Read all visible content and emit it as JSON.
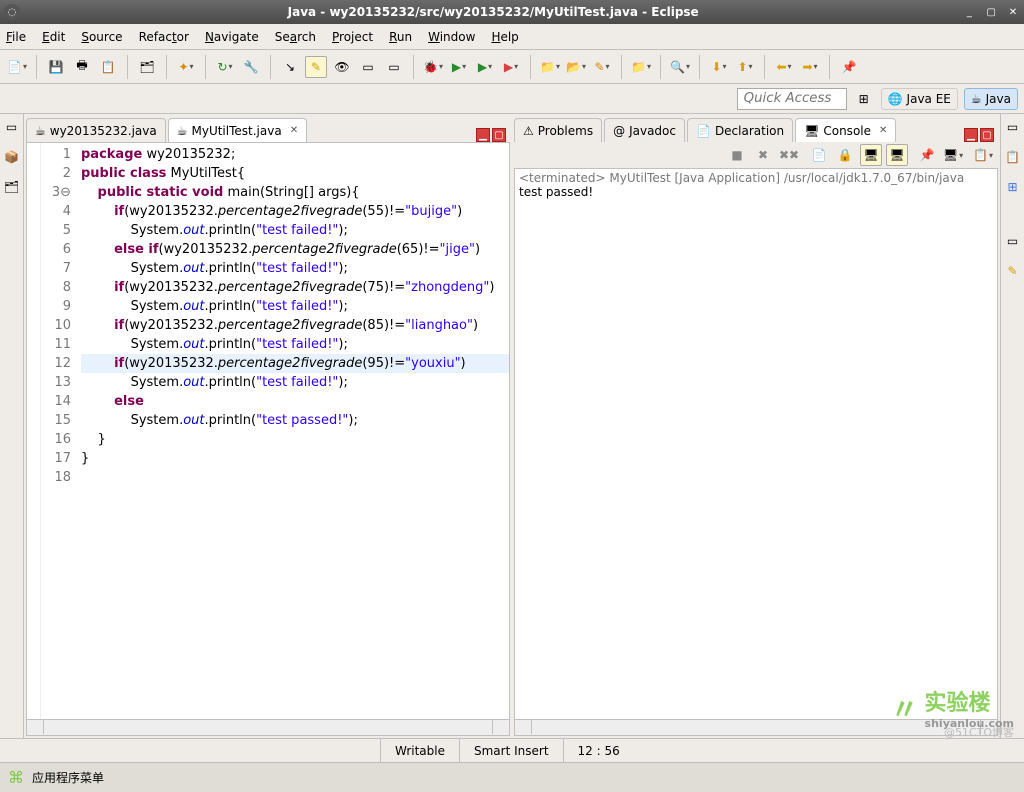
{
  "window": {
    "title": "Java - wy20135232/src/wy20135232/MyUtilTest.java - Eclipse"
  },
  "menu": {
    "file": "File",
    "edit": "Edit",
    "source": "Source",
    "refactor": "Refactor",
    "navigate": "Navigate",
    "search": "Search",
    "project": "Project",
    "run": "Run",
    "window": "Window",
    "help": "Help"
  },
  "quick_access": {
    "placeholder": "Quick Access"
  },
  "perspectives": {
    "javaee": "Java EE",
    "java": "Java"
  },
  "editor_tabs": {
    "tab1": "wy20135232.java",
    "tab2": "MyUtilTest.java"
  },
  "code": {
    "lines": [
      "1",
      "2",
      "3",
      "4",
      "5",
      "6",
      "7",
      "8",
      "9",
      "10",
      "11",
      "12",
      "13",
      "14",
      "15",
      "16",
      "17",
      "18"
    ],
    "l1": {
      "kw": "package",
      "rest": " wy20135232;"
    },
    "l2": {
      "kw1": "public",
      "kw2": " class",
      "rest": " MyUtilTest{"
    },
    "l3": {
      "kw1": "public",
      "kw2": " static",
      "kw3": " void",
      "m": " main",
      "p": "(String[] args){"
    },
    "l4": {
      "kw": "if",
      "obj": "(wy20135232.",
      "met": "percentage2fivegrade",
      "arg": "(55)!=",
      "str": "\"bujige\"",
      "end": ")"
    },
    "l5": {
      "sys": "System.",
      "out": "out",
      "pr": ".println(",
      "str": "\"test failed!\"",
      "end": ");"
    },
    "l6": {
      "kw": "else if",
      "obj": "(wy20135232.",
      "met": "percentage2fivegrade",
      "arg": "(65)!=",
      "str": "\"jige\"",
      "end": ")"
    },
    "l7": {
      "sys": "System.",
      "out": "out",
      "pr": ".println(",
      "str": "\"test failed!\"",
      "end": ");"
    },
    "l8": {
      "kw": "if",
      "obj": "(wy20135232.",
      "met": "percentage2fivegrade",
      "arg": "(75)!=",
      "str": "\"zhongdeng\"",
      "end": ")"
    },
    "l9": {
      "sys": "System.",
      "out": "out",
      "pr": ".println(",
      "str": "\"test failed!\"",
      "end": ");"
    },
    "l10": {
      "kw": "if",
      "obj": "(wy20135232.",
      "met": "percentage2fivegrade",
      "arg": "(85)!=",
      "str": "\"lianghao\"",
      "end": ")"
    },
    "l11": {
      "sys": "System.",
      "out": "out",
      "pr": ".println(",
      "str": "\"test failed!\"",
      "end": ");"
    },
    "l12": {
      "kw": "if",
      "obj": "(wy20135232.",
      "met": "percentage2fivegrade",
      "arg": "(95)!=",
      "str": "\"youxiu\"",
      "end": ")"
    },
    "l13": {
      "sys": "System.",
      "out": "out",
      "pr": ".println(",
      "str": "\"test failed!\"",
      "end": ");"
    },
    "l14": {
      "kw": "else"
    },
    "l15": {
      "sys": "System.",
      "out": "out",
      "pr": ".println(",
      "str": "\"test passed!\"",
      "end": ");"
    },
    "l16": "    }",
    "l17": "}",
    "l18": ""
  },
  "views": {
    "problems": "Problems",
    "javadoc": "Javadoc",
    "declaration": "Declaration",
    "console": "Console"
  },
  "console": {
    "header": "<terminated> MyUtilTest [Java Application] /usr/local/jdk1.7.0_67/bin/java",
    "output": "test passed!"
  },
  "status": {
    "writable": "Writable",
    "insert": "Smart Insert",
    "pos": "12 : 56"
  },
  "taskbar": {
    "appmenu": "应用程序菜单"
  },
  "watermark": {
    "brand": "实验楼",
    "url": "shiyanlou.com",
    "blog": "@51CTO博客"
  }
}
